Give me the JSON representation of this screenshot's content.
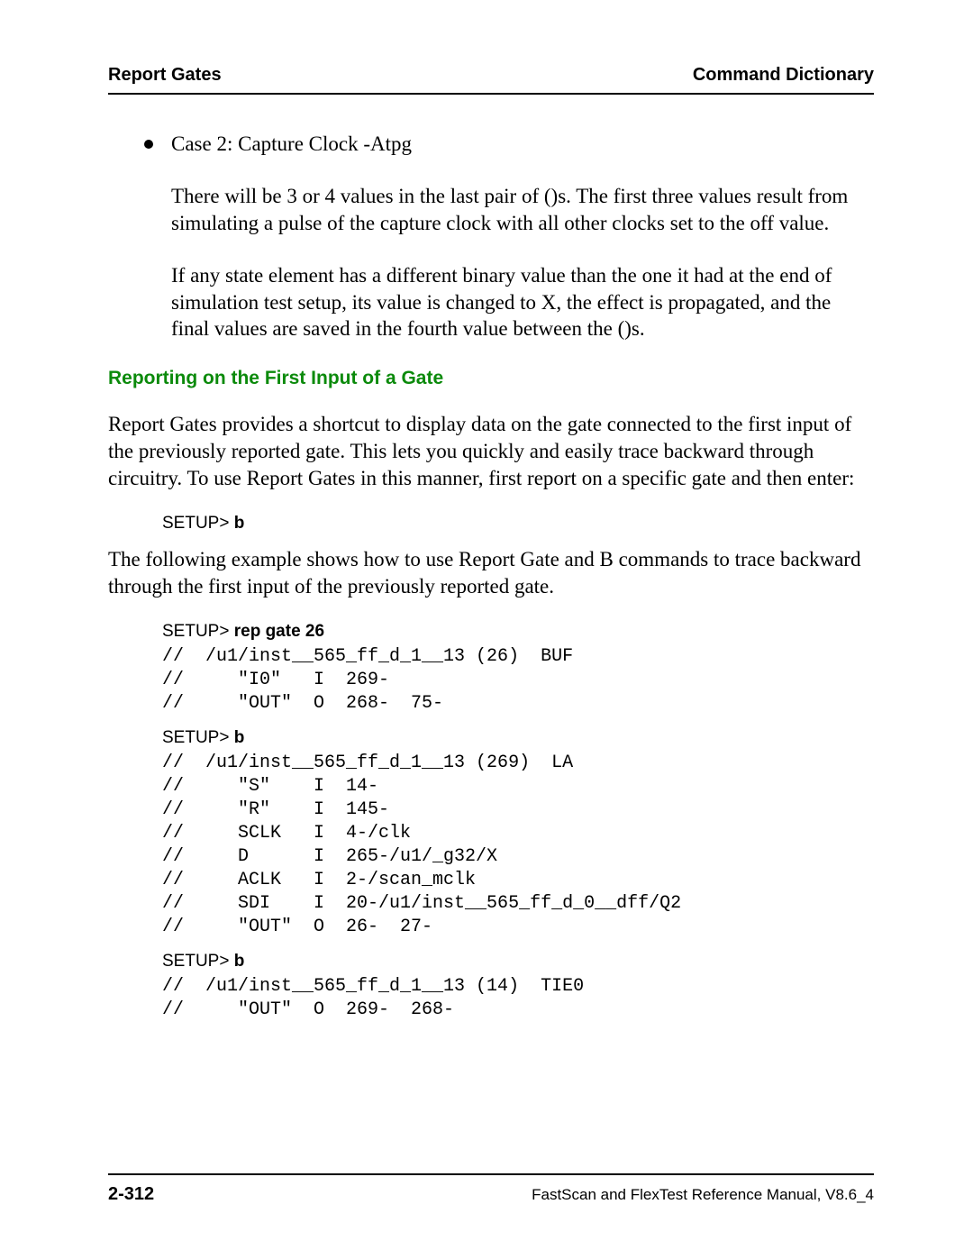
{
  "header": {
    "left": "Report Gates",
    "right": "Command Dictionary"
  },
  "case2": {
    "title": "Case 2: Capture Clock -Atpg",
    "para1": "There will be 3 or 4 values in the last pair of ()s. The first three values result from simulating a pulse of the capture clock with all other clocks set to the off value.",
    "para2": "If any state element has a different binary value than the one it had at the end of simulation test setup, its value is changed to X, the effect is propagated, and the final values are saved in the fourth value between the ()s."
  },
  "section_heading": "Reporting on the First Input of a Gate",
  "section_para1": "Report Gates provides a shortcut to display data on the gate connected to the first input of the previously reported gate. This lets you quickly and easily trace backward through circuitry. To use Report Gates in this manner, first report on a specific gate and then enter:",
  "prompt1": {
    "label": "SETUP> ",
    "cmd": "b"
  },
  "section_para2": "The following example shows how to use Report Gate and B commands to trace backward through the first input of the previously reported gate.",
  "prompt2": {
    "label": "SETUP> ",
    "cmd": "rep gate 26"
  },
  "codeblock1": "//  /u1/inst__565_ff_d_1__13 (26)  BUF\n//     \"I0\"   I  269-\n//     \"OUT\"  O  268-  75-",
  "prompt3": {
    "label": "SETUP> ",
    "cmd": "b"
  },
  "codeblock2": "//  /u1/inst__565_ff_d_1__13 (269)  LA\n//     \"S\"    I  14-\n//     \"R\"    I  145-\n//     SCLK   I  4-/clk\n//     D      I  265-/u1/_g32/X\n//     ACLK   I  2-/scan_mclk\n//     SDI    I  20-/u1/inst__565_ff_d_0__dff/Q2\n//     \"OUT\"  O  26-  27-",
  "prompt4": {
    "label": "SETUP> ",
    "cmd": "b"
  },
  "codeblock3": "//  /u1/inst__565_ff_d_1__13 (14)  TIE0\n//     \"OUT\"  O  269-  268-",
  "footer": {
    "page": "2-312",
    "title": "FastScan and FlexTest Reference Manual, V8.6_4"
  }
}
